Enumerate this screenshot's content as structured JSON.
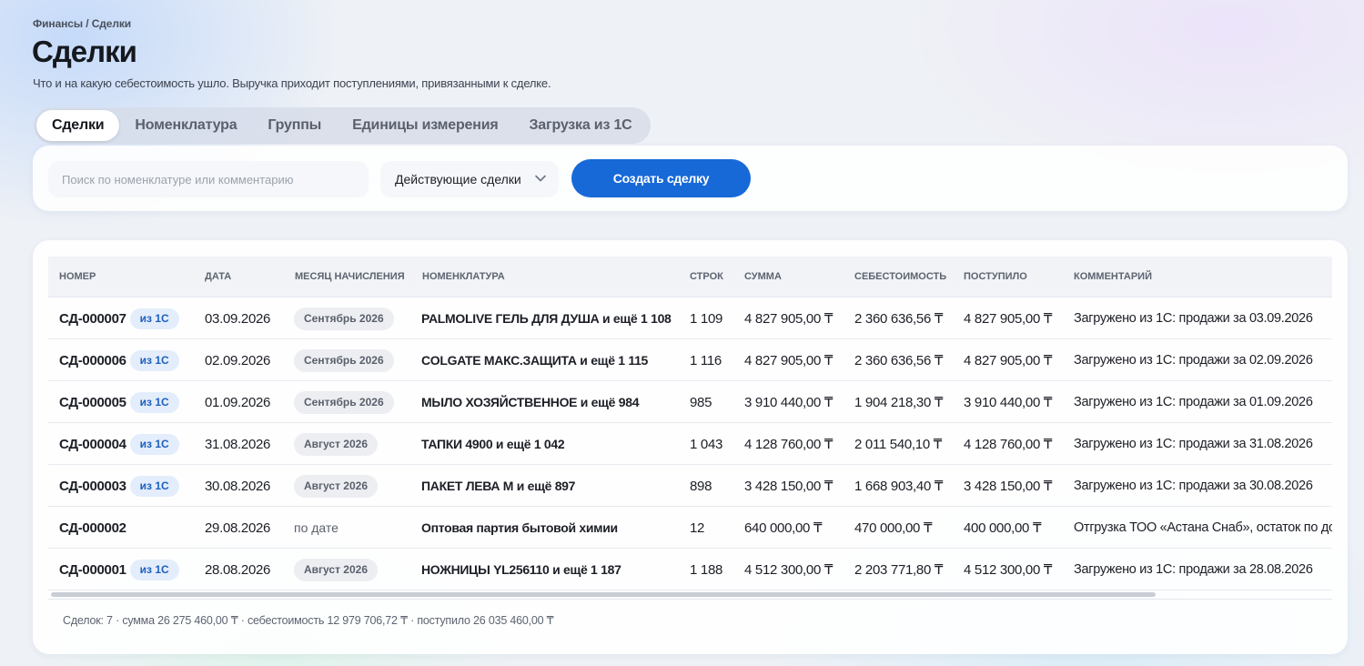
{
  "breadcrumb": "Финансы / Сделки",
  "title": "Сделки",
  "subtitle": "Что и на какую себестоимость ушло. Выручка приходит поступлениями, привязанными к сделке.",
  "tabs": [
    {
      "label": "Сделки",
      "active": true
    },
    {
      "label": "Номенклатура",
      "active": false
    },
    {
      "label": "Группы",
      "active": false
    },
    {
      "label": "Единицы измерения",
      "active": false
    },
    {
      "label": "Загрузка из 1С",
      "active": false
    }
  ],
  "filters": {
    "search_placeholder": "Поиск по номенклатуре или комментарию",
    "search_value": "",
    "status_selected": "Действующие сделки",
    "create_label": "Создать сделку"
  },
  "colors": {
    "accent": "#1769d8",
    "badge_bg": "#e3edfb",
    "badge_text": "#1d5fbf"
  },
  "table": {
    "columns": [
      "НОМЕР",
      "ДАТА",
      "МЕСЯЦ НАЧИСЛЕНИЯ",
      "НОМЕНКЛАТУРА",
      "СТРОК",
      "СУММА",
      "СЕБЕСТОИМОСТЬ",
      "ПОСТУПИЛО",
      "КОММЕНТАРИЙ"
    ],
    "rows": [
      {
        "number": "СД-000007",
        "source": "из 1С",
        "date": "03.09.2026",
        "month": "Сентябрь 2026",
        "month_pill": true,
        "nomenclature": "PALMOLIVE ГЕЛЬ ДЛЯ ДУША и ещё 1 108",
        "lines": "1 109",
        "sum": "4 827 905,00 ₸",
        "cost": "2 360 636,56 ₸",
        "received": "4 827 905,00 ₸",
        "comment": "Загружено из 1С: продажи за 03.09.2026"
      },
      {
        "number": "СД-000006",
        "source": "из 1С",
        "date": "02.09.2026",
        "month": "Сентябрь 2026",
        "month_pill": true,
        "nomenclature": "COLGATE МАКС.ЗАЩИТА и ещё 1 115",
        "lines": "1 116",
        "sum": "4 827 905,00 ₸",
        "cost": "2 360 636,56 ₸",
        "received": "4 827 905,00 ₸",
        "comment": "Загружено из 1С: продажи за 02.09.2026"
      },
      {
        "number": "СД-000005",
        "source": "из 1С",
        "date": "01.09.2026",
        "month": "Сентябрь 2026",
        "month_pill": true,
        "nomenclature": "МЫЛО ХОЗЯЙСТВЕННОЕ и ещё 984",
        "lines": "985",
        "sum": "3 910 440,00 ₸",
        "cost": "1 904 218,30 ₸",
        "received": "3 910 440,00 ₸",
        "comment": "Загружено из 1С: продажи за 01.09.2026"
      },
      {
        "number": "СД-000004",
        "source": "из 1С",
        "date": "31.08.2026",
        "month": "Август 2026",
        "month_pill": true,
        "nomenclature": "ТАПКИ 4900 и ещё 1 042",
        "lines": "1 043",
        "sum": "4 128 760,00 ₸",
        "cost": "2 011 540,10 ₸",
        "received": "4 128 760,00 ₸",
        "comment": "Загружено из 1С: продажи за 31.08.2026"
      },
      {
        "number": "СД-000003",
        "source": "из 1С",
        "date": "30.08.2026",
        "month": "Август 2026",
        "month_pill": true,
        "nomenclature": "ПАКЕТ ЛЕВА М и ещё 897",
        "lines": "898",
        "sum": "3 428 150,00 ₸",
        "cost": "1 668 903,40 ₸",
        "received": "3 428 150,00 ₸",
        "comment": "Загружено из 1С: продажи за 30.08.2026"
      },
      {
        "number": "СД-000002",
        "source": "",
        "date": "29.08.2026",
        "month": "по дате",
        "month_pill": false,
        "nomenclature": "Оптовая партия бытовой химии",
        "lines": "12",
        "sum": "640 000,00 ₸",
        "cost": "470 000,00 ₸",
        "received": "400 000,00 ₸",
        "comment": "Отгрузка ТОО «Астана Снаб», остаток по дог"
      },
      {
        "number": "СД-000001",
        "source": "из 1С",
        "date": "28.08.2026",
        "month": "Август 2026",
        "month_pill": true,
        "nomenclature": "НОЖНИЦЫ YL256110 и ещё 1 187",
        "lines": "1 188",
        "sum": "4 512 300,00 ₸",
        "cost": "2 203 771,80 ₸",
        "received": "4 512 300,00 ₸",
        "comment": "Загружено из 1С: продажи за 28.08.2026"
      }
    ]
  },
  "summary": "Сделок: 7 · сумма 26 275 460,00 ₸ · себестоимость 12 979 706,72 ₸ · поступило 26 035 460,00 ₸"
}
